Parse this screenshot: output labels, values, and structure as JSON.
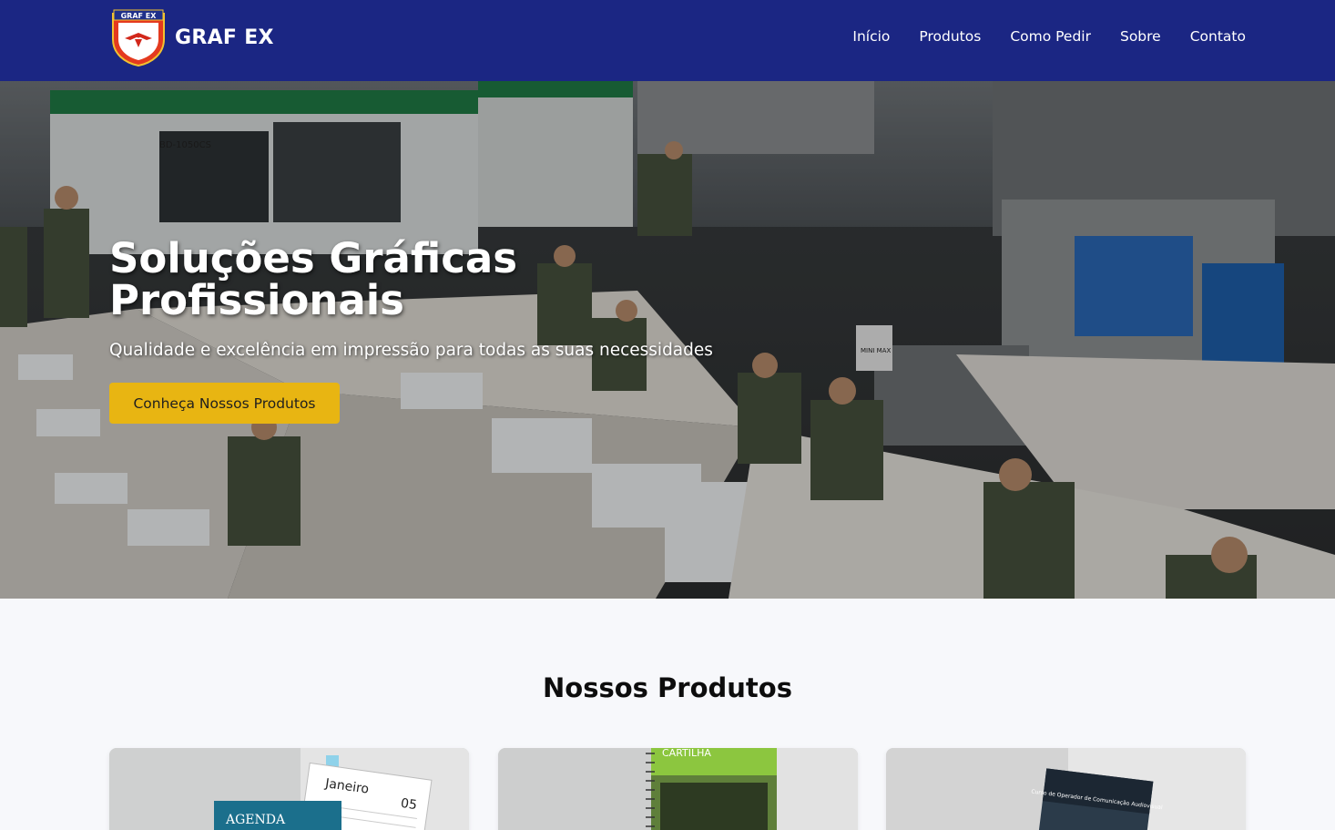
{
  "navbar": {
    "logo_text": "GRAF EX",
    "brand_name": "GRAF EX",
    "links": [
      "Início",
      "Produtos",
      "Como Pedir",
      "Sobre",
      "Contato"
    ]
  },
  "hero": {
    "title": "Soluções Gráficas Profissionais",
    "subtitle": "Qualidade e excelência em impressão para todas as suas necessidades",
    "cta_label": "Conheça Nossos Produtos",
    "machine_labels": [
      "BD-1050CS",
      "MINI MAX"
    ]
  },
  "products": {
    "title": "Nossos Produtos",
    "cards": [
      {
        "image_name": "agenda-product",
        "text": [
          "AGENDA",
          "Janeiro",
          "05"
        ]
      },
      {
        "image_name": "cartilha-product",
        "text": [
          "CARTILHA"
        ]
      },
      {
        "image_name": "apostila-product",
        "text": [
          "Curso de Operador de Comunicação Audiovisual"
        ]
      }
    ]
  },
  "colors": {
    "navbar": "#1b2683",
    "accent": "#e8b512",
    "background": "#f7f8fb"
  }
}
